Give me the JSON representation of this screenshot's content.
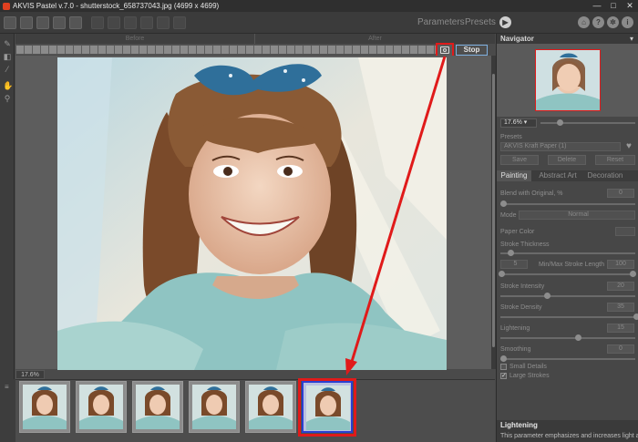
{
  "window": {
    "title": "AKVIS Pastel v.7.0 - shutterstock_658737043.jpg (4699 x 4699)",
    "controls": [
      "—",
      "□",
      "✕"
    ]
  },
  "toolbar": {
    "parameters_label": "Parameters",
    "presets_label": "Presets",
    "run_icon": "play-icon",
    "help_icons": [
      "home-icon",
      "help-icon",
      "gear-icon",
      "info-icon"
    ]
  },
  "view_tabs": {
    "before": "Before",
    "after": "After"
  },
  "processing": {
    "stop_label": "Stop",
    "snapshot_icon": "camera-icon",
    "progress_percent": 100
  },
  "zoom": {
    "value": "17.6%"
  },
  "navigator": {
    "title": "Navigator",
    "zoom_value": "17.6% ▾"
  },
  "presets": {
    "section_label": "Presets",
    "selected": "AKVIS Kraft Paper (1)",
    "save_label": "Save",
    "delete_label": "Delete",
    "reset_label": "Reset"
  },
  "tabs": [
    {
      "label": "Painting",
      "active": true
    },
    {
      "label": "Abstract Art",
      "active": false
    },
    {
      "label": "Decoration",
      "active": false
    }
  ],
  "params": {
    "blend_label": "Blend with Original, %",
    "blend_value": "0",
    "mode_label": "Mode",
    "mode_value": "Normal",
    "paper_color_label": "Paper Color",
    "stroke_thickness_label": "Stroke Thickness",
    "stroke_thickness_value": "5",
    "stroke_length_label": "Min/Max Stroke Length",
    "stroke_length_value": "100",
    "stroke_intensity_label": "Stroke Intensity",
    "stroke_intensity_value": "20",
    "stroke_density_label": "Stroke Density",
    "stroke_density_value": "35",
    "lightening_label": "Lightening",
    "lightening_value": "15",
    "smoothing_label": "Smoothing",
    "smoothing_value": "0",
    "small_details_label": "Small Details",
    "large_strokes_label": "Large Strokes"
  },
  "hint": {
    "title": "Lightening",
    "text": "This parameter emphasizes and increases light areas."
  },
  "filmstrip": {
    "count": 6,
    "selected_index": 5
  },
  "colors": {
    "highlight_red": "#e01a1a",
    "selection_blue": "#2a3fd0",
    "panel_bg": "#474747"
  }
}
